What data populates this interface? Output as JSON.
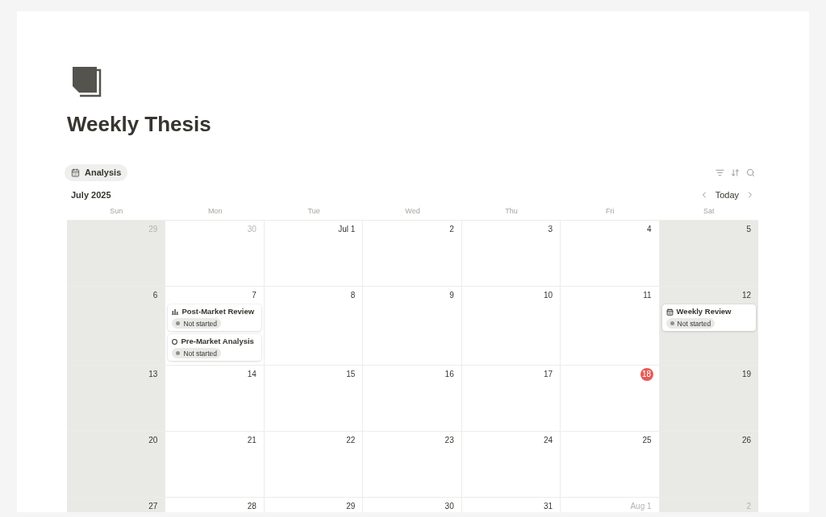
{
  "page": {
    "title": "Weekly Thesis"
  },
  "views": [
    {
      "label": "Analysis",
      "selected": true
    }
  ],
  "calendar": {
    "month": "July 2025",
    "today_button": "Today",
    "weekdays": [
      {
        "label": "Sun",
        "weekend": true
      },
      {
        "label": "Mon",
        "weekend": false
      },
      {
        "label": "Tue",
        "weekend": false
      },
      {
        "label": "Wed",
        "weekend": false
      },
      {
        "label": "Thu",
        "weekend": false
      },
      {
        "label": "Fri",
        "weekend": false
      },
      {
        "label": "Sat",
        "weekend": true
      }
    ],
    "weeks": [
      [
        {
          "day": "29",
          "muted": true,
          "today": false
        },
        {
          "day": "30",
          "muted": true,
          "today": false
        },
        {
          "day": "Jul 1",
          "muted": false,
          "today": false
        },
        {
          "day": "2",
          "muted": false,
          "today": false
        },
        {
          "day": "3",
          "muted": false,
          "today": false
        },
        {
          "day": "4",
          "muted": false,
          "today": false
        },
        {
          "day": "5",
          "muted": false,
          "today": false
        }
      ],
      [
        {
          "day": "6",
          "muted": false,
          "today": false
        },
        {
          "day": "7",
          "muted": false,
          "today": false,
          "events": [
            {
              "kind": "chart",
              "title": "Post-Market Review",
              "status": "Not started"
            },
            {
              "kind": "ring",
              "title": "Pre-Market Analysis",
              "status": "Not started"
            }
          ]
        },
        {
          "day": "8",
          "muted": false,
          "today": false
        },
        {
          "day": "9",
          "muted": false,
          "today": false
        },
        {
          "day": "10",
          "muted": false,
          "today": false
        },
        {
          "day": "11",
          "muted": false,
          "today": false
        },
        {
          "day": "12",
          "muted": false,
          "today": false,
          "events": [
            {
              "kind": "calendar",
              "title": "Weekly Review",
              "status": "Not started"
            }
          ]
        }
      ],
      [
        {
          "day": "13",
          "muted": false,
          "today": false
        },
        {
          "day": "14",
          "muted": false,
          "today": false
        },
        {
          "day": "15",
          "muted": false,
          "today": false
        },
        {
          "day": "16",
          "muted": false,
          "today": false
        },
        {
          "day": "17",
          "muted": false,
          "today": false
        },
        {
          "day": "18",
          "muted": false,
          "today": true
        },
        {
          "day": "19",
          "muted": false,
          "today": false
        }
      ],
      [
        {
          "day": "20",
          "muted": false,
          "today": false
        },
        {
          "day": "21",
          "muted": false,
          "today": false
        },
        {
          "day": "22",
          "muted": false,
          "today": false
        },
        {
          "day": "23",
          "muted": false,
          "today": false
        },
        {
          "day": "24",
          "muted": false,
          "today": false
        },
        {
          "day": "25",
          "muted": false,
          "today": false
        },
        {
          "day": "26",
          "muted": false,
          "today": false
        }
      ],
      [
        {
          "day": "27",
          "muted": false,
          "today": false
        },
        {
          "day": "28",
          "muted": false,
          "today": false
        },
        {
          "day": "29",
          "muted": false,
          "today": false
        },
        {
          "day": "30",
          "muted": false,
          "today": false
        },
        {
          "day": "31",
          "muted": false,
          "today": false
        },
        {
          "day": "Aug 1",
          "muted": true,
          "today": false
        },
        {
          "day": "2",
          "muted": true,
          "today": false
        }
      ]
    ]
  }
}
